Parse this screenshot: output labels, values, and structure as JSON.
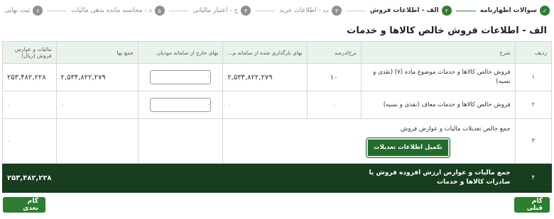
{
  "stepper": {
    "steps": [
      {
        "num": "",
        "label": "سوالات اظهارنامه",
        "state": "done"
      },
      {
        "num": "۲",
        "label": "الف - اطلاعات فروش",
        "state": "active"
      },
      {
        "num": "۳",
        "label": "ب - اطلاعات خرید",
        "state": "pending"
      },
      {
        "num": "۴",
        "label": "ج - اعتبار مالیاتی",
        "state": "pending"
      },
      {
        "num": "۵",
        "label": "د - محاسبه مانده بدهی مالیات",
        "state": "pending"
      },
      {
        "num": "۶",
        "label": "ثبت نهایی",
        "state": "pending"
      }
    ]
  },
  "page_title": "الف - اطلاعات فروش خالص کالاها و خدمات",
  "table": {
    "headers": {
      "idx": "ردیف",
      "desc": "شرح",
      "rate": "نرخ/درصد",
      "sys": "بهای بارگذاری شده از سامانه م...",
      "out": "بهای خارج از سامانه مودیان",
      "sum": "جمع بها",
      "tax": "مالیات و عوارض فروش (ریال)"
    },
    "rows": [
      {
        "idx": "۱",
        "desc": "فروش خالص کالاها و خدمات موضوع ماده (۷) (نقدی و نسیه)",
        "rate": "۱۰",
        "sys": "۲,۵۳۴,۸۲۲,۲۷۹",
        "out": "۰",
        "sum": "۲,۵۳۴,۸۲۲,۲۷۹",
        "tax": "۲۵۳,۴۸۲,۲۲۸"
      },
      {
        "idx": "۲",
        "desc": "فروش خالص کالاها و خدمات معاف (نقدی و نسیه)",
        "rate": "۰",
        "sys": "۰",
        "out": "۰",
        "sum": "۰",
        "tax": "۰"
      },
      {
        "idx": "۳",
        "desc": "جمع خالص تعدیلات مالیات و عوارض فروش",
        "button": "تکمیل اطلاعات تعدیلات",
        "tax": "۰"
      }
    ],
    "total": {
      "idx": "۴",
      "desc": "جمع مالیات و عوارض ارزش افزوده فروش یا صادرات کالاها و خدمات",
      "tax": "۲۵۳,۴۸۲,۲۲۸"
    }
  },
  "nav": {
    "prev": "گام قبلی",
    "next": "گام بعدی"
  },
  "colors": {
    "accent": "#2e7d32",
    "dark": "#183d1f",
    "header_bg": "#e9f3ea"
  }
}
